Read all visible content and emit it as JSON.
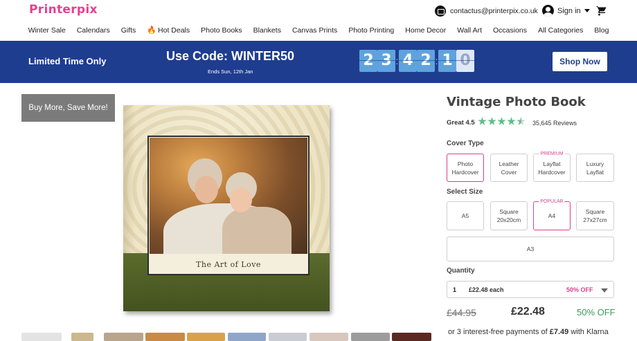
{
  "header": {
    "logo": "Printerpix",
    "contact_email": "contactus@printerpix.co.uk",
    "signin_label": "Sign in"
  },
  "nav": [
    "Winter Sale",
    "Calendars",
    "Gifts",
    "Hot Deals",
    "Photo Books",
    "Blankets",
    "Canvas Prints",
    "Photo Printing",
    "Home Decor",
    "Wall Art",
    "Occasions",
    "All Categories",
    "Blog"
  ],
  "banner": {
    "limited": "Limited Time Only",
    "code": "Use Code: WINTER50",
    "ends": "Ends Sun, 12th Jan",
    "countdown": [
      "2",
      "3",
      "4",
      "2",
      "1",
      "0"
    ],
    "cta": "Shop Now"
  },
  "product": {
    "buy_more": "Buy More, Save More!",
    "cover_caption": "The Art of Love",
    "title": "Vintage Photo Book",
    "rating_word": "Great 4.5",
    "rating": 4.5,
    "reviews": "35,645 Reviews",
    "cover_label": "Cover Type",
    "cover_options": [
      {
        "line1": "Photo",
        "line2": "Hardcover",
        "tag": "",
        "selected": true
      },
      {
        "line1": "Leather",
        "line2": "Cover",
        "tag": "",
        "selected": false
      },
      {
        "line1": "Layflat",
        "line2": "Hardcover",
        "tag": "PREMIUM",
        "selected": false
      },
      {
        "line1": "Luxury",
        "line2": "Layflat",
        "tag": "",
        "selected": false
      }
    ],
    "size_label": "Select Size",
    "size_options": [
      {
        "line1": "A5",
        "line2": "",
        "tag": "",
        "selected": false
      },
      {
        "line1": "Square",
        "line2": "20x20cm",
        "tag": "",
        "selected": false
      },
      {
        "line1": "A4",
        "line2": "",
        "tag": "POPULAR",
        "selected": true
      },
      {
        "line1": "Square",
        "line2": "27x27cm",
        "tag": "",
        "selected": false
      },
      {
        "line1": "A3",
        "line2": "",
        "tag": "",
        "selected": false
      }
    ],
    "quantity_label": "Quantity",
    "quantity": "1",
    "each_price": "£22.48 each",
    "qty_off": "50% OFF",
    "old_price": "£44.95",
    "new_price": "£22.48",
    "pct_off": "50% OFF",
    "klarna_text": "or 3 interest-free payments of",
    "klarna_amount": "£7.49",
    "klarna_with": "with Klarna"
  },
  "colors": {
    "brand_pink": "#e0438f",
    "banner_blue": "#1f3d8f",
    "star_green": "#5cbf8a",
    "off_green": "#3c9b5a"
  }
}
